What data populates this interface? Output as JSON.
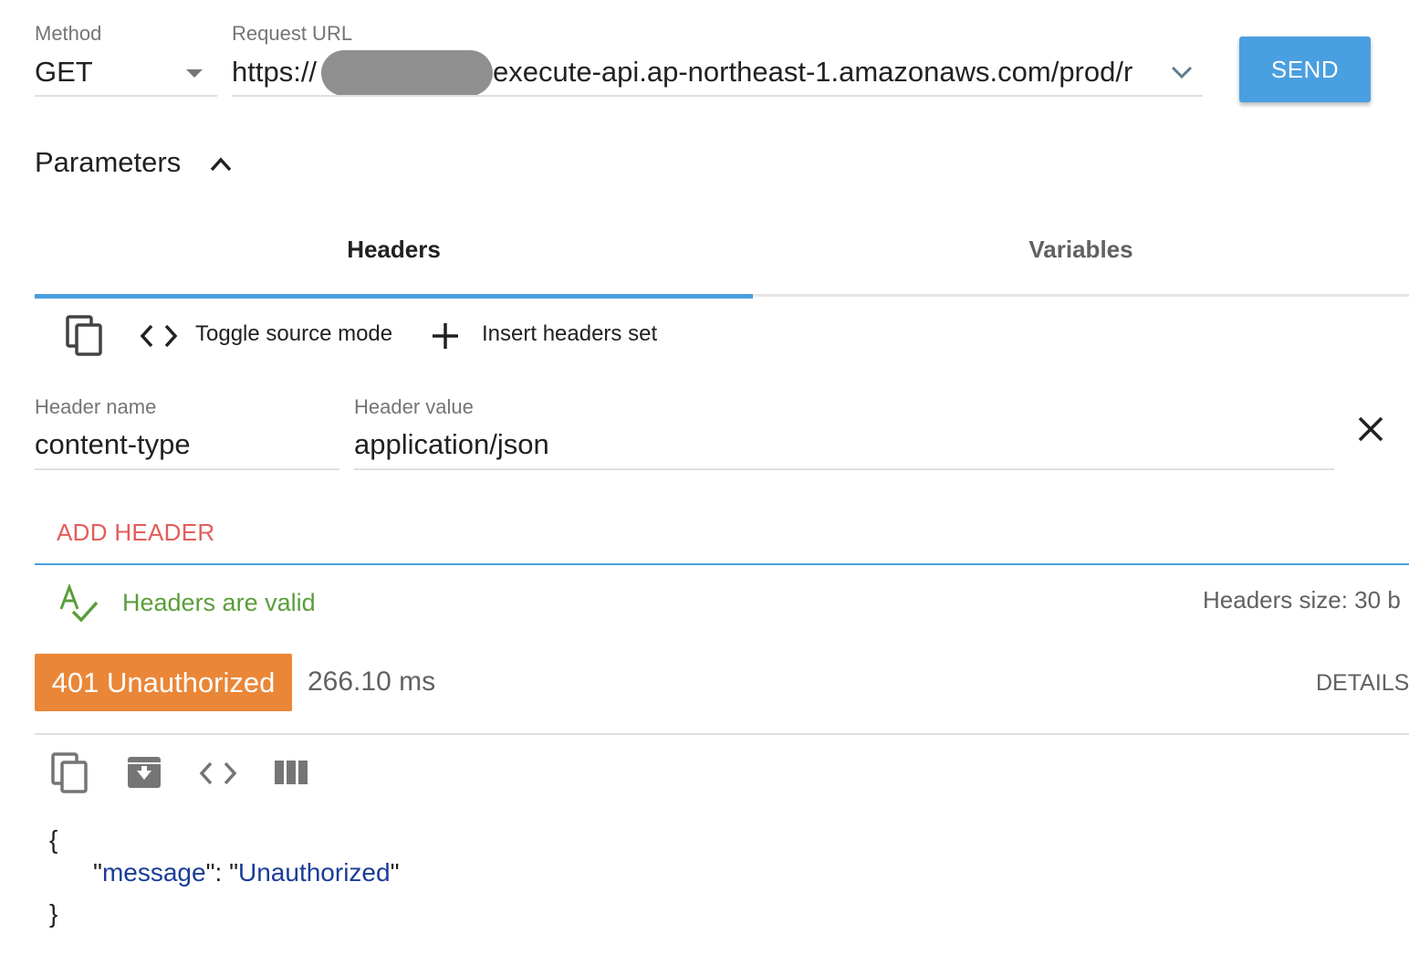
{
  "request": {
    "method_label": "Method",
    "method_value": "GET",
    "url_label": "Request URL",
    "url_prefix": "https://",
    "url_suffix": "execute-api.ap-northeast-1.amazonaws.com/prod/r",
    "send_label": "SEND"
  },
  "parameters": {
    "title": "Parameters"
  },
  "tabs": [
    {
      "label": "Headers",
      "active": true
    },
    {
      "label": "Variables",
      "active": false
    }
  ],
  "headers_toolbar": {
    "toggle_source_label": "Toggle source mode",
    "insert_set_label": "Insert headers set"
  },
  "header_row": {
    "name_label": "Header name",
    "name_value": "content-type",
    "value_label": "Header value",
    "value_value": "application/json"
  },
  "add_header_label": "ADD HEADER",
  "validation": {
    "message": "Headers are valid",
    "size_text": "Headers size: 30 b"
  },
  "response": {
    "status": "401 Unauthorized",
    "time": "266.10 ms",
    "details_label": "DETAILS",
    "body": {
      "open": "{",
      "key": "message",
      "value": "Unauthorized",
      "close": "}"
    }
  },
  "colors": {
    "accent": "#4a9fe0",
    "add_header": "#e35d5b",
    "valid": "#5a9e3a",
    "status_badge": "#ea8637",
    "json_string": "#1a3d99"
  },
  "icons": [
    "chevron-down-icon",
    "chevron-up-icon",
    "copy-icon",
    "code-icon",
    "plus-icon",
    "close-icon",
    "spellcheck-icon",
    "save-icon",
    "columns-icon"
  ]
}
